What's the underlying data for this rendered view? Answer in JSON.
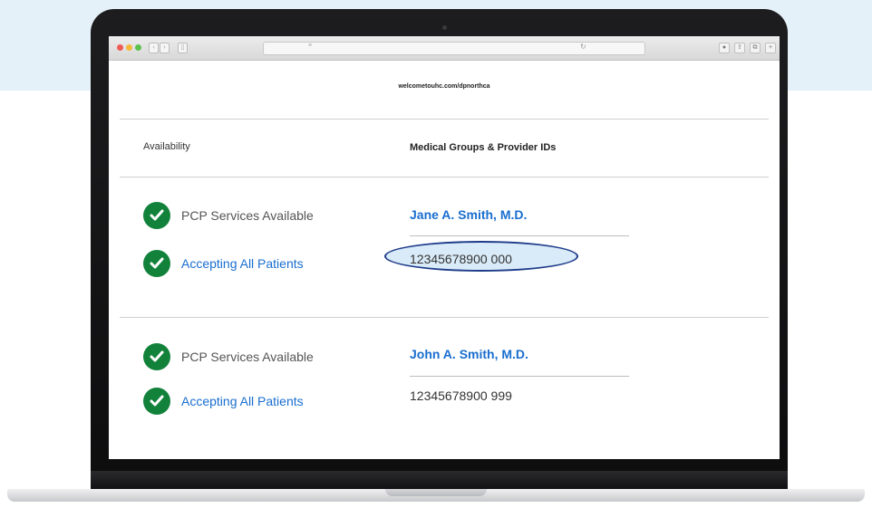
{
  "browser": {
    "url_caption": "welcometouhc.com/dpnorthca"
  },
  "table": {
    "columns": [
      "Availability",
      "Medical Groups & Provider IDs"
    ],
    "rows": [
      {
        "status": [
          {
            "label": "PCP Services Available",
            "icon": "check-circle-icon"
          },
          {
            "label": "Accepting All Patients",
            "icon": "check-circle-icon"
          }
        ],
        "provider_name": "Jane A. Smith, M.D.",
        "provider_id": "12345678900 000",
        "highlighted": true
      },
      {
        "status": [
          {
            "label": "PCP Services Available",
            "icon": "check-circle-icon"
          },
          {
            "label": "Accepting All Patients",
            "icon": "check-circle-icon"
          }
        ],
        "provider_name": "John A. Smith, M.D.",
        "provider_id": "12345678900 999",
        "highlighted": false
      }
    ]
  },
  "colors": {
    "check_green": "#12823b",
    "link_blue": "#196ecf",
    "highlight_outline": "#1f3c8a",
    "background_band": "#e4f1f9"
  }
}
